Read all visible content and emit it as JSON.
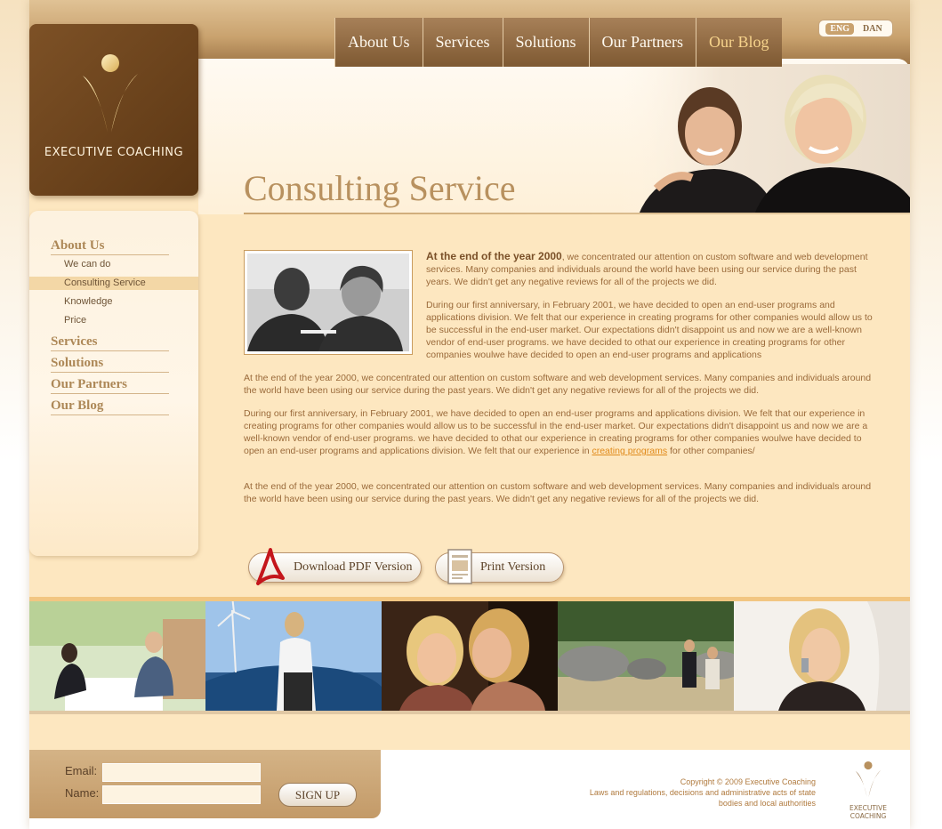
{
  "brand": {
    "name": "EXECUTIVE COACHING"
  },
  "nav": {
    "items": [
      {
        "label": "About Us"
      },
      {
        "label": "Services"
      },
      {
        "label": "Solutions"
      },
      {
        "label": "Our Partners"
      },
      {
        "label": "Our Blog"
      }
    ],
    "active_index": 4
  },
  "language": {
    "current": "ENG",
    "other": "DAN"
  },
  "page": {
    "title": "Consulting Service"
  },
  "sidebar": {
    "sections": [
      {
        "label": "About Us",
        "subitems": [
          {
            "label": "We can do"
          },
          {
            "label": "Consulting Service",
            "current": true
          },
          {
            "label": "Knowledge"
          },
          {
            "label": "Price"
          }
        ]
      },
      {
        "label": "Services"
      },
      {
        "label": "Solutions"
      },
      {
        "label": "Our Partners"
      },
      {
        "label": "Our Blog"
      }
    ]
  },
  "content": {
    "p1_bold": "At the end of the year 2000",
    "p1_rest": ", we concentrated our attention on custom software and web development services. Many companies and individuals around the world have been using our service during the past years. We didn't get any negative reviews for all of the projects we did.",
    "p2": "During our first anniversary, in February 2001, we have decided to open an end-user programs and applications division. We felt that our experience in creating programs for other companies would allow us to be successful in the end-user market. Our expectations didn't disappoint us and now we are a well-known vendor of end-user programs. we have decided to othat our experience in creating programs for other companies woulwe have decided to open an end-user programs and applications",
    "p3": "At the end of the year 2000, we concentrated our attention on custom software and web development services. Many companies and individuals around the world have been using our service during the past years. We didn't get any negative reviews for all of the projects we did.",
    "p4_before": "During our first anniversary, in February 2001, we have decided to open an end-user programs and applications division. We felt that our experience in creating programs for other companies would allow us to be successful in the end-user market. Our expectations didn't disappoint us and now we are a well-known vendor of end-user programs. we have decided to othat our experience in creating programs for other companies woulwe have decided to open an end-user programs and applications division. We felt that our experience in ",
    "p4_link": "creating programs",
    "p4_after": " for other companies/",
    "p5": "At the end of the year 2000, we concentrated our attention on custom software and web development services. Many companies and individuals around the world have been using our service during the past years. We didn't get any negative reviews for all of the projects we did."
  },
  "actions": {
    "pdf_label": "Download PDF Version",
    "print_label": "Print Version"
  },
  "signup": {
    "email_label": "Email:",
    "name_label": "Name:",
    "email_value": "",
    "name_value": "",
    "button_label": "SIGN UP"
  },
  "footer": {
    "copyright": "Copyright © 2009 Executive Coaching",
    "legal_line1": "Laws and regulations, decisions and administrative acts of state",
    "legal_line2": "bodies and local authorities",
    "logo_text": "EXECUTIVE COACHING"
  },
  "colors": {
    "brand_brown": "#6b4520",
    "accent_gold": "#b8915f",
    "link_orange": "#e08a1a",
    "page_bg": "#fde7c0"
  }
}
